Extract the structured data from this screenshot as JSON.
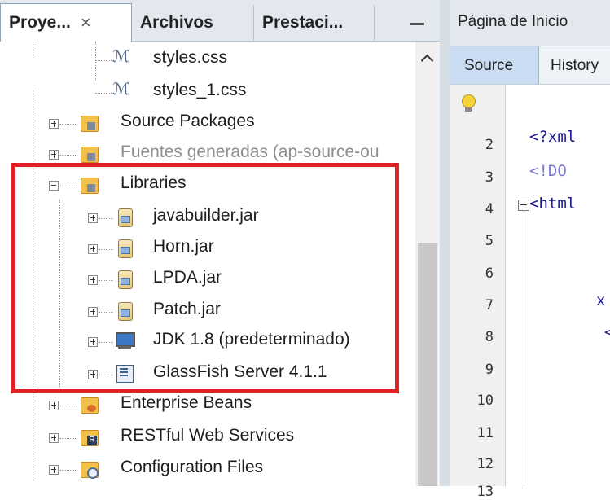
{
  "project_panel": {
    "tabs": [
      {
        "label": "Proye..."
      },
      {
        "label": "Archivos"
      },
      {
        "label": "Prestaci..."
      }
    ],
    "close_glyph": "×",
    "minimize_glyph": "—",
    "tree": [
      {
        "label": "styles.css",
        "icon": "css-file-icon"
      },
      {
        "label": "styles_1.css",
        "icon": "css-file-icon"
      },
      {
        "label": "Source Packages",
        "icon": "source-packages-icon"
      },
      {
        "label": "Fuentes generadas (ap-source-ou",
        "icon": "generated-sources-icon"
      },
      {
        "label": "Libraries",
        "icon": "libraries-folder-icon"
      },
      {
        "label": "javabuilder.jar",
        "icon": "jar-icon"
      },
      {
        "label": "Horn.jar",
        "icon": "jar-icon"
      },
      {
        "label": "LPDA.jar",
        "icon": "jar-icon"
      },
      {
        "label": "Patch.jar",
        "icon": "jar-icon"
      },
      {
        "label": "JDK 1.8 (predeterminado)",
        "icon": "jdk-icon"
      },
      {
        "label": "GlassFish Server 4.1.1",
        "icon": "server-icon"
      },
      {
        "label": "Enterprise Beans",
        "icon": "enterprise-beans-icon"
      },
      {
        "label": "RESTful Web Services",
        "icon": "rest-services-icon"
      },
      {
        "label": "Configuration Files",
        "icon": "config-files-icon"
      }
    ]
  },
  "editor": {
    "tab_label": "Página de Inicio",
    "view_tabs": [
      "Source",
      "History"
    ],
    "line_numbers": [
      "2",
      "3",
      "4",
      "5",
      "6",
      "7",
      "8",
      "9",
      "10",
      "11",
      "12",
      "13"
    ],
    "code": {
      "line2": "<?xml",
      "line3": "<!DO",
      "line4": "<html",
      "line7": "x",
      "line8": "<"
    }
  },
  "colors": {
    "highlight_border": "#e02026",
    "selected_tab": "#c9dcf2"
  }
}
